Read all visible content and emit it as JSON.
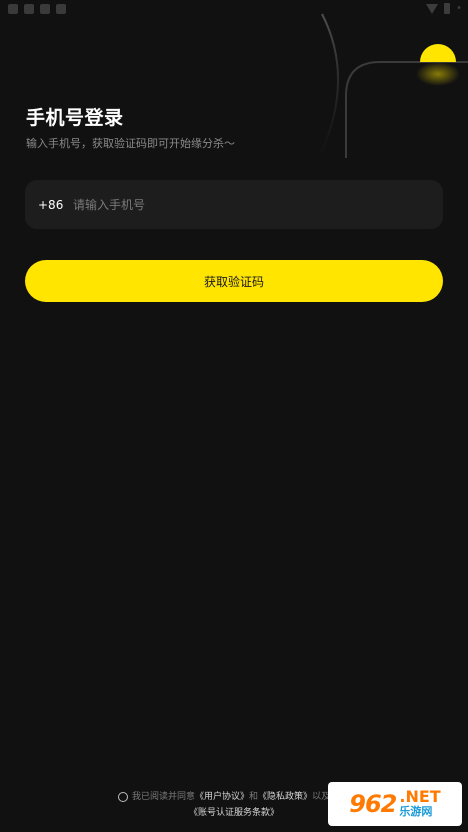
{
  "header": {
    "title": "手机号登录",
    "subtitle": "输入手机号，获取验证码即可开始缘分杀～"
  },
  "phone": {
    "country_code": "+86",
    "placeholder": "请输入手机号",
    "value": ""
  },
  "actions": {
    "get_code_label": "获取验证码"
  },
  "agreement": {
    "prefix": "我已阅读并同意",
    "user_agreement": "《用户协议》",
    "and": "和",
    "privacy_policy": "《隐私政策》",
    "also": "以及",
    "account_terms": "《账号认证服务条款》"
  },
  "watermark": {
    "number": "962",
    "net": ".NET",
    "site": "乐游网"
  },
  "colors": {
    "accent": "#ffe500",
    "background": "#111111",
    "input_background": "#1d1d1d"
  }
}
